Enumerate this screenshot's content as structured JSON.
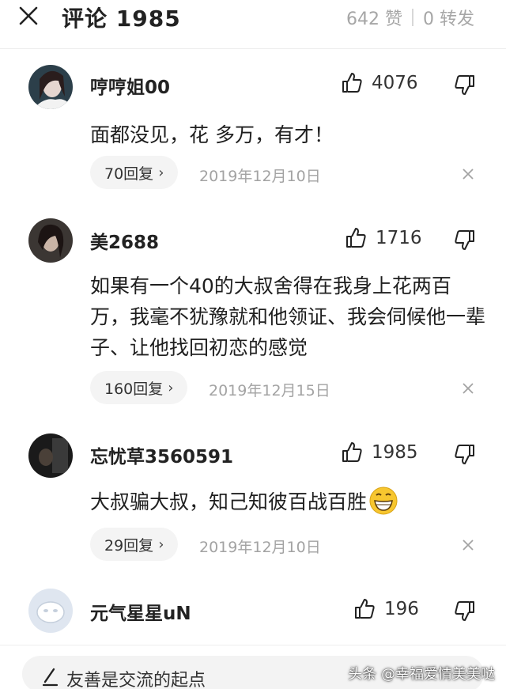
{
  "header": {
    "title": "评论 1985",
    "likes": "642 赞",
    "shares": "0 转发"
  },
  "comments": [
    {
      "username": "哼哼姐00",
      "likes": "4076",
      "text": "面都没见，花   多万，有才！",
      "replies": "70回复",
      "date": "2019年12月10日"
    },
    {
      "username": "美2688",
      "likes": "1716",
      "text": "如果有一个40的大叔舍得在我身上花两百万，我毫不犹豫就和他领证、我会伺候他一辈子、让他找回初恋的感觉",
      "replies": "160回复",
      "date": "2019年12月15日"
    },
    {
      "username": "忘忧草3560591",
      "likes": "1985",
      "text": "大叔骗大叔，知己知彼百战百胜",
      "replies": "29回复",
      "date": "2019年12月10日"
    },
    {
      "username": "元气星星uN",
      "likes": "196"
    }
  ],
  "input": {
    "placeholder": "友善是交流的起点"
  },
  "watermark": "头条 @幸福爱情美美哒",
  "icons": {
    "close": "close-icon",
    "like": "thumbs-up-icon",
    "dislike": "thumbs-down-icon",
    "dismiss": "dismiss-x-icon",
    "pen": "pen-icon",
    "emoji": "grinning-face-emoji"
  },
  "colors": {
    "text": "#222222",
    "muted": "#a6a6a6",
    "pill": "#f4f4f4"
  }
}
